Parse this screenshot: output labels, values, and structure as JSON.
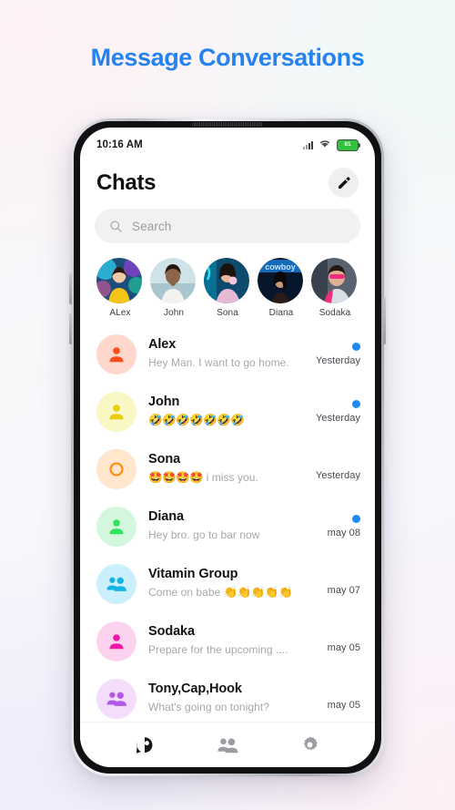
{
  "page": {
    "title": "Message Conversations",
    "title_color": "#2483f0"
  },
  "status_bar": {
    "time": "10:16 AM",
    "signal_icon": "cellular-signal-icon",
    "wifi_icon": "wifi-icon",
    "battery_level": "81",
    "battery_color": "#2fc23a"
  },
  "header": {
    "title": "Chats",
    "compose_icon": "pencil-icon"
  },
  "search": {
    "placeholder": "Search",
    "icon": "search-icon"
  },
  "stories": [
    {
      "name": "ALex",
      "avatar_kind": "photo",
      "c1": "#4aa3d8",
      "c2": "#f2c61e",
      "c3": "#12304f"
    },
    {
      "name": "John",
      "avatar_kind": "photo",
      "c1": "#cfe3e6",
      "c2": "#5d4436",
      "c3": "#9fb9bd"
    },
    {
      "name": "Sona",
      "avatar_kind": "photo",
      "c1": "#18c7e0",
      "c2": "#e6a7c6",
      "c3": "#0d5f86"
    },
    {
      "name": "Diana",
      "avatar_kind": "photo",
      "c1": "#1a5fa8",
      "c2": "#0a1a33",
      "c3": "#2f8fd0"
    },
    {
      "name": "Sodaka",
      "avatar_kind": "photo",
      "c1": "#3a4a63",
      "c2": "#ef2f7d",
      "c3": "#c2cbd6"
    }
  ],
  "chats": [
    {
      "name": "Alex",
      "message": "Hey Man. I want to go home.",
      "emoji": "",
      "time": "Yesterday",
      "unread": true,
      "avatar_bg": "#ffd6cc",
      "avatar_fg": "#ff4a1c",
      "avatar_icon": "person-icon"
    },
    {
      "name": "John",
      "message": "",
      "emoji": "🤣🤣🤣🤣🤣🤣🤣",
      "time": "Yesterday",
      "unread": true,
      "avatar_bg": "#f9f7c4",
      "avatar_fg": "#e8cc08",
      "avatar_icon": "person-icon"
    },
    {
      "name": "Sona",
      "message": " i miss you.",
      "emoji": "🤩🤩🤩🤩",
      "time": "Yesterday",
      "unread": false,
      "avatar_bg": "#ffe6cc",
      "avatar_fg": "#fb8c11",
      "avatar_icon": "ring-icon"
    },
    {
      "name": "Diana",
      "message": "Hey bro. go to bar now",
      "emoji": "",
      "time": "may 08",
      "unread": true,
      "avatar_bg": "#d2f7dd",
      "avatar_fg": "#2fe35e",
      "avatar_icon": "person-icon"
    },
    {
      "name": "Vitamin Group",
      "message": "Come on babe ",
      "emoji": "👏👏👏👏👏",
      "time": "may 07",
      "unread": false,
      "avatar_bg": "#ccf0fb",
      "avatar_fg": "#13b5e8",
      "avatar_icon": "group-icon"
    },
    {
      "name": "Sodaka",
      "message": "Prepare for the upcoming ....",
      "emoji": "",
      "time": "may 05",
      "unread": false,
      "avatar_bg": "#fbd3ee",
      "avatar_fg": "#f01aa8",
      "avatar_icon": "person-icon"
    },
    {
      "name": "Tony,Cap,Hook",
      "message": "What's going on tonight?",
      "emoji": "",
      "time": "may 05",
      "unread": false,
      "avatar_bg": "#f3ddfb",
      "avatar_fg": "#b martin",
      "avatar_icon": "group-icon"
    }
  ],
  "bottom_nav": [
    {
      "icon": "chat-bubble-icon",
      "active": true
    },
    {
      "icon": "people-icon",
      "active": false
    },
    {
      "icon": "gear-icon",
      "active": false
    }
  ]
}
